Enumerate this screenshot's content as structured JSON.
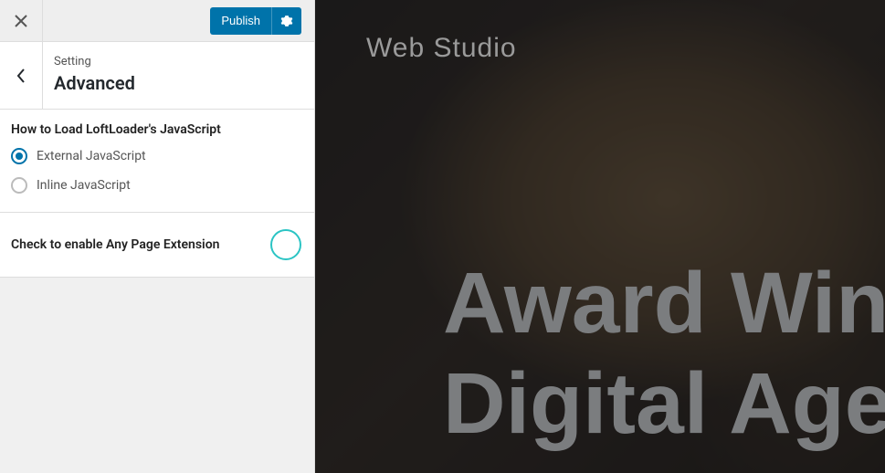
{
  "topbar": {
    "publish_label": "Publish"
  },
  "heading": {
    "small": "Setting",
    "big": "Advanced"
  },
  "section_js": {
    "title": "How to Load LoftLoader's JavaScript",
    "option_external": "External JavaScript",
    "option_inline": "Inline JavaScript"
  },
  "toggle": {
    "label": "Check to enable Any Page Extension"
  },
  "preview": {
    "brand": "Web Studio",
    "hero_line1": "Award Win",
    "hero_line2": "Digital Age"
  }
}
